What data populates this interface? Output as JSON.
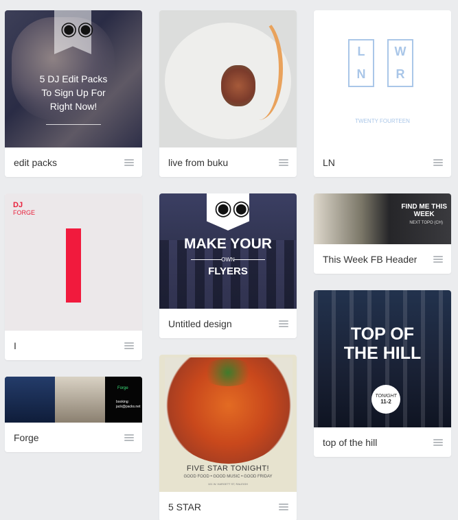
{
  "colors": {
    "background": "#ebecee",
    "card": "#ffffff",
    "title_text": "#333333",
    "menu_icon": "#b7bbbf"
  },
  "designs": [
    {
      "title": "edit packs",
      "thumbnail_text": [
        "5 DJ Edit Packs",
        "To Sign Up For",
        "Right Now!"
      ],
      "icons": [
        "dj-headphones-logo-icon"
      ]
    },
    {
      "title": "live from buku",
      "icons": [
        "plated-food-image"
      ]
    },
    {
      "title": "LN",
      "thumbnail_text": {
        "box_left": [
          "L",
          "N"
        ],
        "box_right": [
          "W",
          "R"
        ],
        "caption": "TWENTY FOURTEEN"
      }
    },
    {
      "title": "I",
      "thumbnail_text": {
        "dj": "DJ",
        "forge": "FORGE"
      }
    },
    {
      "title": "Untitled design",
      "thumbnail_text": {
        "line1": "MAKE YOUR",
        "line2": "OWN",
        "line3": "FLYERS"
      },
      "icons": [
        "dj-headphones-logo-icon"
      ]
    },
    {
      "title": "This Week FB Header",
      "thumbnail_text": {
        "line1": "FIND ME THIS",
        "line2": "WEEK",
        "line3": "NEXT TOPO (CH)"
      }
    },
    {
      "title": "Forge",
      "thumbnail_text": {
        "line1": "Forge",
        "booking1": "booking:",
        "booking2": "jack@packs.net"
      }
    },
    {
      "title": "5 STAR",
      "thumbnail_text": {
        "line1": "FIVE STAR TONIGHT!",
        "line2": "GOOD FOOD • GOOD MUSIC • GOOD FRIDAY",
        "line3": "101 W. HARGETT ST, RALEIGH"
      }
    },
    {
      "title": "top of the hill",
      "thumbnail_text": {
        "line1": "TOP OF",
        "line2": "THE HILL",
        "badge1": "TONIGHT",
        "badge2": "11-2"
      }
    }
  ]
}
